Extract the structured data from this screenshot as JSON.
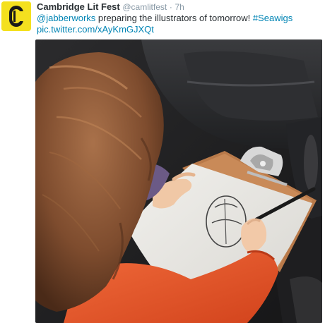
{
  "tweet": {
    "display_name": "Cambridge Lit Fest",
    "handle": "@camlitfest",
    "separator": "·",
    "time": "7h",
    "mention": "@jabberworks",
    "text": " preparing the illustrators of tomorrow! ",
    "hashtag": "#Seawigs",
    "pic_link": "pic.twitter.com/xAyKmGJXQt"
  },
  "colors": {
    "link": "#0084b4",
    "avatar_bg": "#f4e01f",
    "meta": "#8899a6"
  },
  "icons": {
    "avatar": "cambridge-lit-fest-logo-icon"
  }
}
